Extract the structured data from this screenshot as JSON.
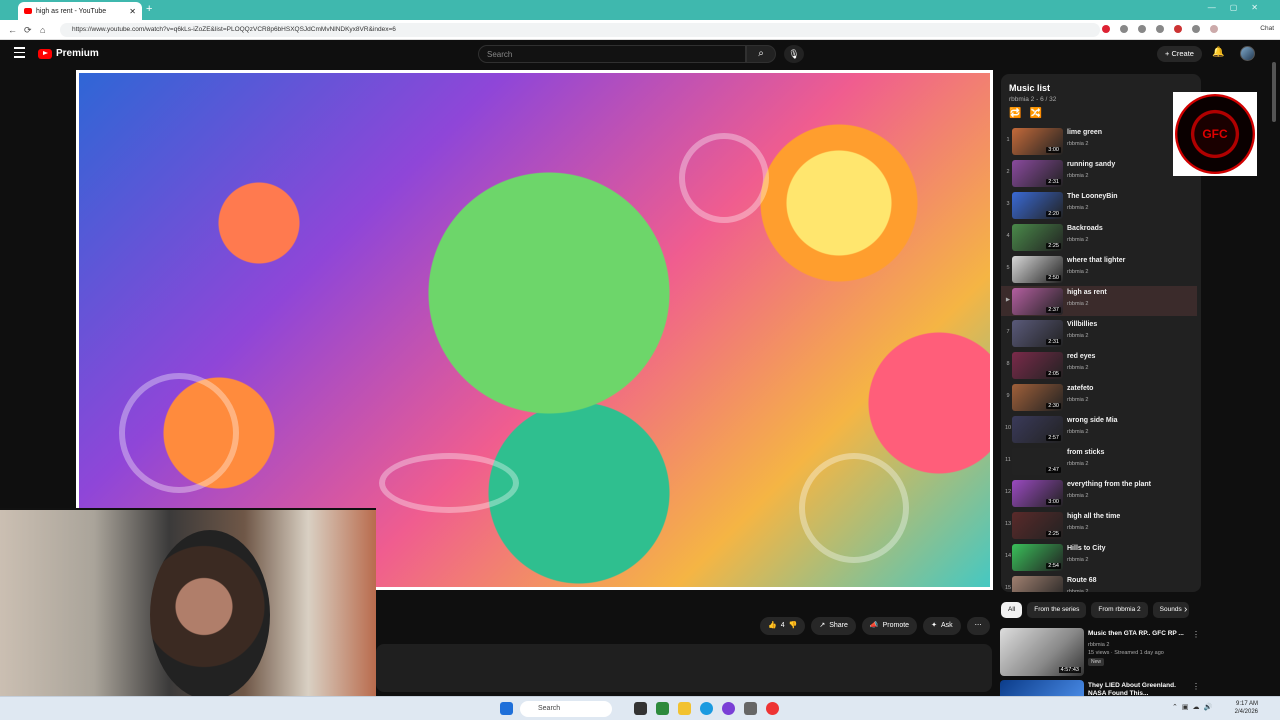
{
  "browser": {
    "tab_title": "high as rent - YouTube",
    "url": "https://www.youtube.com/watch?v=q6kLs-iZoZE&list=PLOQQzVCR8p6bHSXQSJdCmMvNlNDKyx8VR&index=6",
    "chat_label": "Chat"
  },
  "header": {
    "logo_text": "Premium",
    "search_placeholder": "Search",
    "create_label": "Create"
  },
  "playlist": {
    "title": "Music list",
    "subtitle": "rbbmia 2 - 6 / 32",
    "items": [
      {
        "index": "1",
        "title": "lime green",
        "channel": "rbbmia 2",
        "duration": "3:00"
      },
      {
        "index": "2",
        "title": "running sandy",
        "channel": "rbbmia 2",
        "duration": "2:31"
      },
      {
        "index": "3",
        "title": "The LooneyBin",
        "channel": "rbbmia 2",
        "duration": "2:20"
      },
      {
        "index": "4",
        "title": "Backroads",
        "channel": "rbbmia 2",
        "duration": "2:25"
      },
      {
        "index": "5",
        "title": "where that lighter",
        "channel": "rbbmia 2",
        "duration": "2:50"
      },
      {
        "index": "▶",
        "title": "high as rent",
        "channel": "rbbmia 2",
        "duration": "2:37"
      },
      {
        "index": "7",
        "title": "Villbillies",
        "channel": "rbbmia 2",
        "duration": "2:31"
      },
      {
        "index": "8",
        "title": "red eyes",
        "channel": "rbbmia 2",
        "duration": "2:05"
      },
      {
        "index": "9",
        "title": "zatefeto",
        "channel": "rbbmia 2",
        "duration": "2:30"
      },
      {
        "index": "10",
        "title": "wrong side Mia",
        "channel": "rbbmia 2",
        "duration": "2:57"
      },
      {
        "index": "11",
        "title": "from sticks",
        "channel": "rbbmia 2",
        "duration": "2:47"
      },
      {
        "index": "12",
        "title": "everything from the plant",
        "channel": "rbbmia 2",
        "duration": "3:00"
      },
      {
        "index": "13",
        "title": "high all the time",
        "channel": "rbbmia 2",
        "duration": "2:25"
      },
      {
        "index": "14",
        "title": "Hills to City",
        "channel": "rbbmia 2",
        "duration": "2:54"
      },
      {
        "index": "15",
        "title": "Route 68",
        "channel": "rbbmia 2",
        "duration": ""
      }
    ]
  },
  "actions": {
    "like_count": "4",
    "share": "Share",
    "promote": "Promote",
    "ask": "Ask"
  },
  "chips": [
    "All",
    "From the series",
    "From rbbmia 2",
    "Sounds"
  ],
  "recommendations": [
    {
      "title": "Music then GTA RP.. GFC RP ...",
      "channel": "rbbmia 2",
      "meta": "15 views · Streamed 1 day ago",
      "badge": "New",
      "duration": "4:57:43"
    },
    {
      "title": "They LIED About Greenland. NASA Found This...",
      "channel": "",
      "meta": "",
      "badge": "",
      "duration": ""
    }
  ],
  "overlay": {
    "logo_text": "GFC"
  },
  "taskbar": {
    "search_label": "Search",
    "time": "9:17 AM",
    "date": "2/4/2026"
  },
  "colors": {
    "browser_accent": "#3fb8ae",
    "yt_red": "#ff0000",
    "bg": "#0f0f0f"
  }
}
